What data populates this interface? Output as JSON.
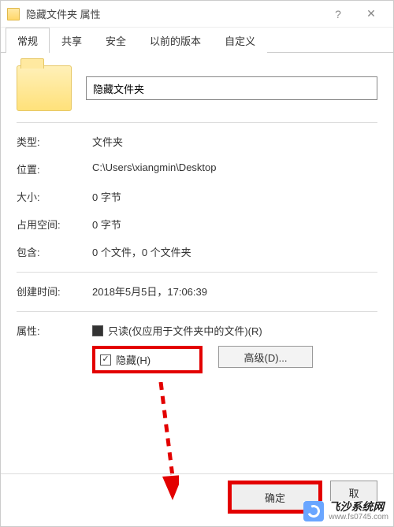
{
  "titlebar": {
    "title": "隐藏文件夹 属性"
  },
  "tabs": {
    "general": "常规",
    "sharing": "共享",
    "security": "安全",
    "previous": "以前的版本",
    "custom": "自定义"
  },
  "folder_name": "隐藏文件夹",
  "rows": {
    "type_label": "类型:",
    "type_value": "文件夹",
    "location_label": "位置:",
    "location_value": "C:\\Users\\xiangmin\\Desktop",
    "size_label": "大小:",
    "size_value": "0 字节",
    "ondisk_label": "占用空间:",
    "ondisk_value": "0 字节",
    "contains_label": "包含:",
    "contains_value": "0 个文件，0 个文件夹",
    "created_label": "创建时间:",
    "created_value": "2018年5月5日，17:06:39",
    "attr_label": "属性:"
  },
  "attrs": {
    "readonly": "只读(仅应用于文件夹中的文件)(R)",
    "hidden": "隐藏(H)",
    "advanced": "高级(D)..."
  },
  "buttons": {
    "ok": "确定",
    "cancel": "取"
  },
  "watermark": {
    "name": "飞沙系统网",
    "url": "www.fs0745.com"
  }
}
